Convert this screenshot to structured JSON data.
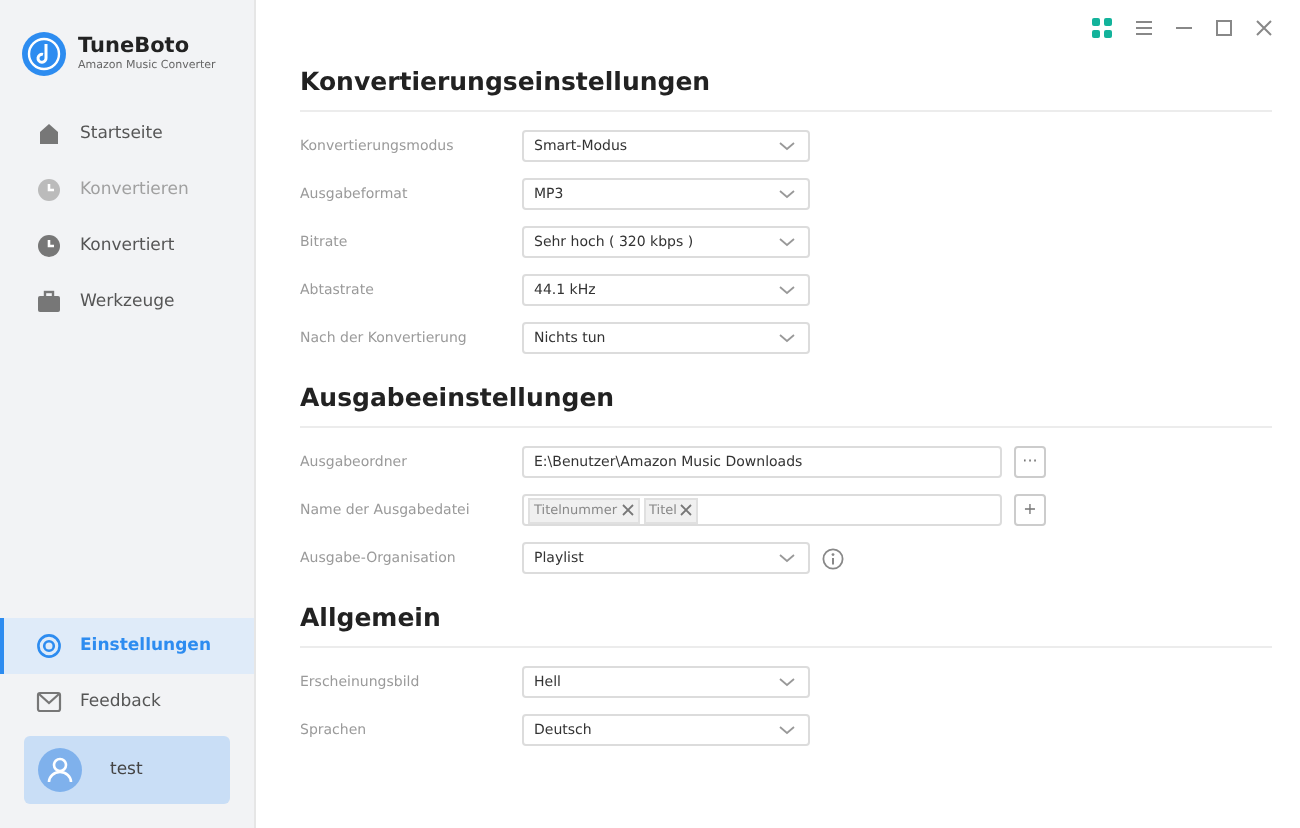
{
  "app": {
    "name": "TuneBoto",
    "subtitle": "Amazon Music Converter"
  },
  "sidebar": {
    "items": [
      {
        "label": "Startseite",
        "selected": false,
        "disabled": false
      },
      {
        "label": "Konvertieren",
        "selected": false,
        "disabled": true
      },
      {
        "label": "Konvertiert",
        "selected": false,
        "disabled": false
      },
      {
        "label": "Werkzeuge",
        "selected": false,
        "disabled": false
      }
    ],
    "bottom_items": [
      {
        "label": "Einstellungen",
        "selected": true,
        "disabled": false
      },
      {
        "label": "Feedback",
        "selected": false,
        "disabled": false
      }
    ],
    "user": {
      "name": "test"
    }
  },
  "sections": [
    {
      "title": "Konvertierungseinstellungen",
      "rows": [
        {
          "kind": "select",
          "label": "Konvertierungsmodus",
          "value": "Smart-Modus"
        },
        {
          "kind": "select",
          "label": "Ausgabeformat",
          "value": "MP3"
        },
        {
          "kind": "select",
          "label": "Bitrate",
          "value": "Sehr hoch ( 320 kbps )"
        },
        {
          "kind": "select",
          "label": "Abtastrate",
          "value": "44.1 kHz"
        },
        {
          "kind": "select",
          "label": "Nach der Konvertierung",
          "value": "Nichts tun"
        }
      ]
    },
    {
      "title": "Ausgabeeinstellungen",
      "rows": [
        {
          "kind": "path",
          "label": "Ausgabeordner",
          "value": "E:\\Benutzer\\Amazon Music Downloads",
          "button": "···"
        },
        {
          "kind": "tags",
          "label": "Name der Ausgabedatei",
          "tags": [
            "Titelnummer",
            "Titel"
          ],
          "button": "+"
        },
        {
          "kind": "select_info",
          "label": "Ausgabe-Organisation",
          "value": "Playlist"
        }
      ]
    },
    {
      "title": "Allgemein",
      "rows": [
        {
          "kind": "select",
          "label": "Erscheinungsbild",
          "value": "Hell"
        },
        {
          "kind": "select",
          "label": "Sprachen",
          "value": "Deutsch"
        }
      ]
    }
  ]
}
